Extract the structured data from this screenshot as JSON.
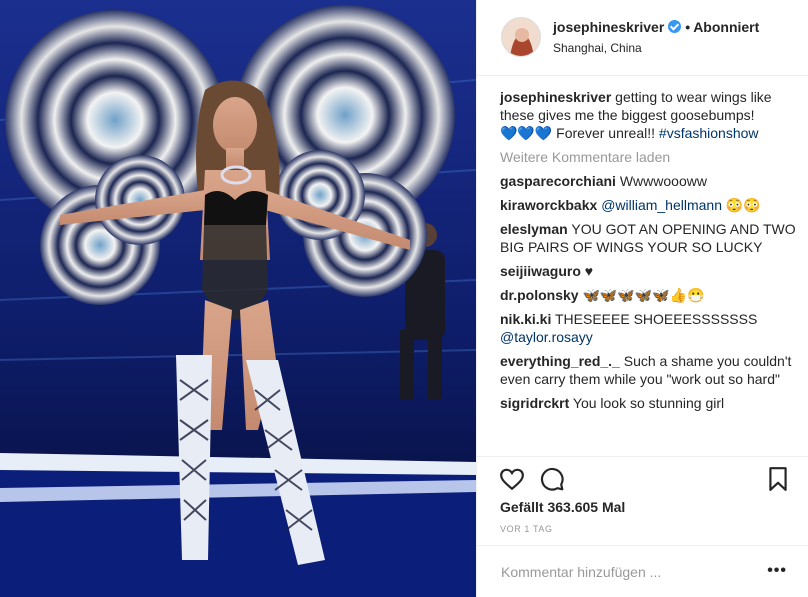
{
  "post": {
    "username": "josephineskriver",
    "separator": "•",
    "follow_status": "Abonniert",
    "location": "Shanghai, China",
    "caption": {
      "user": "josephineskriver",
      "text_1": " getting to wear wings like these gives me the biggest goosebumps!",
      "hearts": "💙💙💙",
      "text_2": " Forever unreal!! ",
      "hashtag": "#vsfashionshow"
    },
    "load_more": "Weitere Kommentare laden",
    "comments": [
      {
        "user": "gasparecorchiani",
        "text": " Wwwwoooww"
      },
      {
        "user": "kiraworckbakx",
        "text": " ",
        "mention": "@william_hellmann",
        "emoji": " 😳😳"
      },
      {
        "user": "eleslyman",
        "text": " YOU GOT AN OPENING AND TWO BIG PAIRS OF WINGS YOUR SO LUCKY"
      },
      {
        "user": "seijiiwaguro",
        "text": " ♥"
      },
      {
        "user": "dr.polonsky",
        "text": " ",
        "emoji": "🦋🦋🦋🦋🦋👍😷"
      },
      {
        "user": "nik.ki.ki",
        "text": " THESEEEE SHOEEESSSSSSS ",
        "mention": "@taylor.rosayy"
      },
      {
        "user": "everything_red_._",
        "text": " Such a shame you couldn't even carry them while you \"work out so hard\""
      },
      {
        "user": "sigridrckrt",
        "text": " You look so stunning girl"
      }
    ],
    "likes": "Gefällt 363.605 Mal",
    "time": "VOR 1 TAG",
    "add_comment_placeholder": "Kommentar hinzufügen ...",
    "more_options": "•••"
  },
  "icons": {
    "like": "heart-icon",
    "comment": "comment-icon",
    "save": "bookmark-icon",
    "verified": "verified-badge-icon"
  },
  "colors": {
    "link": "#003569",
    "verified": "#3897f0",
    "muted": "#999999",
    "text": "#262626"
  }
}
